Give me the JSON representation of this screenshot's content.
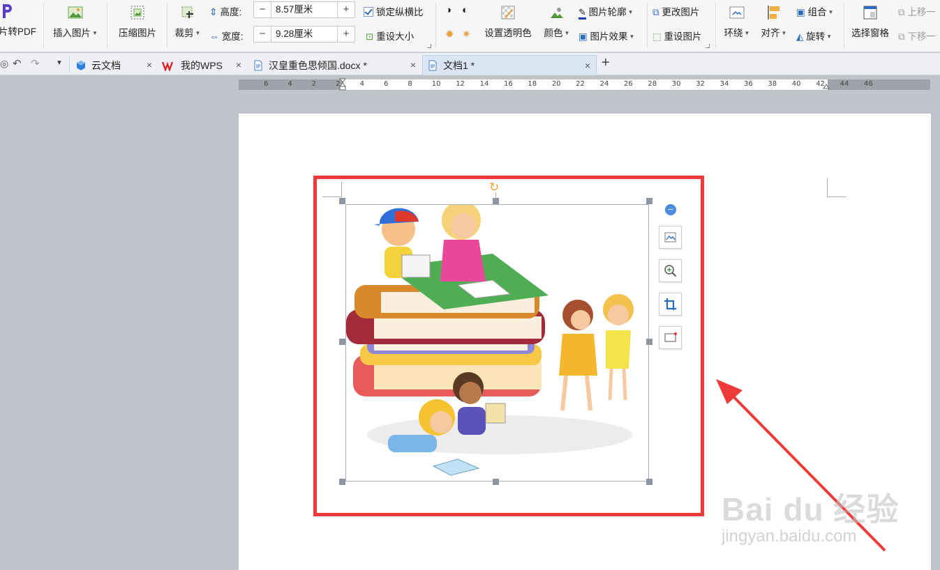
{
  "ribbon": {
    "to_pdf": "片转PDF",
    "insert_picture": "插入图片",
    "compress_picture": "压缩图片",
    "crop": "裁剪",
    "height_label": "高度:",
    "height_value": "8.57厘米",
    "width_label": "宽度:",
    "width_value": "9.28厘米",
    "minus": "−",
    "plus": "+",
    "lock_ratio": "锁定纵横比",
    "reset_size": "重设大小",
    "set_transparent": "设置透明色",
    "color": "颜色",
    "picture_outline": "图片轮廓",
    "picture_effect": "图片效果",
    "change_picture": "更改图片",
    "reset_picture": "重设图片",
    "wrap": "环绕",
    "align": "对齐",
    "group": "组合",
    "rotate": "旋转",
    "selection_pane": "选择窗格",
    "bring_forward": "上移一",
    "send_backward": "下移一"
  },
  "tabs": [
    {
      "label": "云文档"
    },
    {
      "label": "我的WPS"
    },
    {
      "label": "汉皇重色思倾国.docx *"
    },
    {
      "label": "文档1 *"
    }
  ],
  "tab_close": "×",
  "new_tab": "+",
  "ruler_ticks": [
    "6",
    "4",
    "2",
    "2",
    "4",
    "6",
    "8",
    "10",
    "12",
    "14",
    "16",
    "18",
    "20",
    "22",
    "24",
    "26",
    "28",
    "30",
    "32",
    "34",
    "36",
    "38",
    "40",
    "42",
    "44",
    "46"
  ],
  "watermark": {
    "brand": "Bai du 经验",
    "url": "jingyan.baidu.com"
  },
  "colors": {
    "highlight_red": "#ef3a3a",
    "accent_blue": "#2b6bbd",
    "rotate_orange": "#f0a030"
  }
}
